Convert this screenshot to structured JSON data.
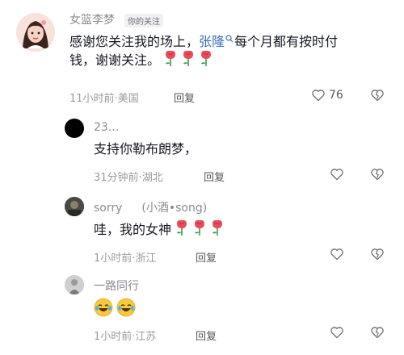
{
  "comments": [
    {
      "user": "女篮李梦",
      "tag": "你的关注",
      "text_line1_prefix": "感谢您关注我的场上，",
      "mention": "张隆",
      "text_line1_suffix": "每个月都有按时付",
      "text_line2": "钱，谢谢关注。",
      "time": "11小时前",
      "location": "美国",
      "reply_label": "回复",
      "like_count": "76",
      "roses": 3
    },
    {
      "user": "23...",
      "text": "支持你勒布朗梦，",
      "time": "31分钟前",
      "location": "湖北",
      "reply_label": "回复"
    },
    {
      "user": "sorry",
      "user_suffix": "(小酒•song)",
      "text": "哇，我的女神",
      "roses": 3,
      "time": "1小时前",
      "location": "浙江",
      "reply_label": "回复"
    },
    {
      "user": "一路同行",
      "text_emoji": [
        "laughing-crying-emoji",
        "laughing-crying-emoji"
      ],
      "time": "1小时前",
      "location": "江苏",
      "reply_label": "回复"
    }
  ],
  "icons": {
    "like": "heart-outline-icon",
    "dislike": "broken-heart-outline-icon",
    "rose": "rose-emoji"
  },
  "colors": {
    "mention": "#3a6fb3",
    "meta": "#9a9ba1",
    "rose": "#e94b5a"
  }
}
